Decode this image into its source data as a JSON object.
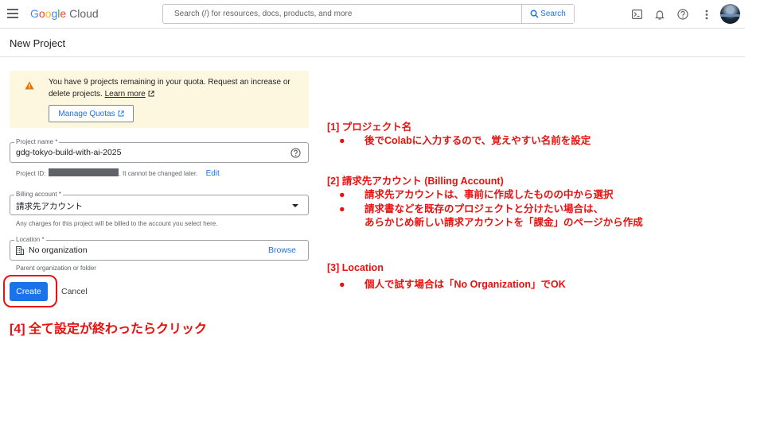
{
  "topbar": {
    "logo_text": "Google Cloud",
    "search_placeholder": "Search (/) for resources, docs, products, and more",
    "search_button": "Search",
    "icons": [
      "menu-icon",
      "terminal-icon",
      "bell-icon",
      "help-icon",
      "more-vert-icon",
      "avatar"
    ]
  },
  "page": {
    "title": "New Project"
  },
  "quota": {
    "message": "You have 9 projects remaining in your quota. Request an increase or delete projects.",
    "learn_more": "Learn more",
    "button": "Manage Quotas"
  },
  "form": {
    "project_name": {
      "label": "Project name *",
      "value": "gdg-tokyo-build-with-ai-2025"
    },
    "project_id": {
      "prefix": "Project ID:",
      "suffix": ". It cannot be changed later.",
      "edit": "Edit"
    },
    "billing": {
      "label": "Billing account *",
      "value": "請求先アカウント",
      "help": "Any charges for this project will be billed to the account you select here."
    },
    "location": {
      "label": "Location *",
      "value": "No organization",
      "browse": "Browse",
      "help": "Parent organization or folder"
    },
    "create": "Create",
    "cancel": "Cancel"
  },
  "annotations": {
    "a1_title": "[1] プロジェクト名",
    "a1_b1": "後でColabに入力するので、覚えやすい名前を設定",
    "a2_title": "[2] 請求先アカウント (Billing Account)",
    "a2_b1": "請求先アカウントは、事前に作成したものの中から選択",
    "a2_b2": "請求書などを既存のプロジェクトと分けたい場合は、",
    "a2_b2_cont": "あらかじめ新しい請求アカウントを「課金」のページから作成",
    "a3_title": "[3] Location",
    "a3_b1": "個人で試す場合は「No Organization」でOK",
    "a4": "[4] 全て設定が終わったらクリック",
    "bullet": "●"
  },
  "colors": {
    "annotation": "#e8110f",
    "primary": "#1a73e8",
    "warning_bg": "#fef7e0"
  }
}
